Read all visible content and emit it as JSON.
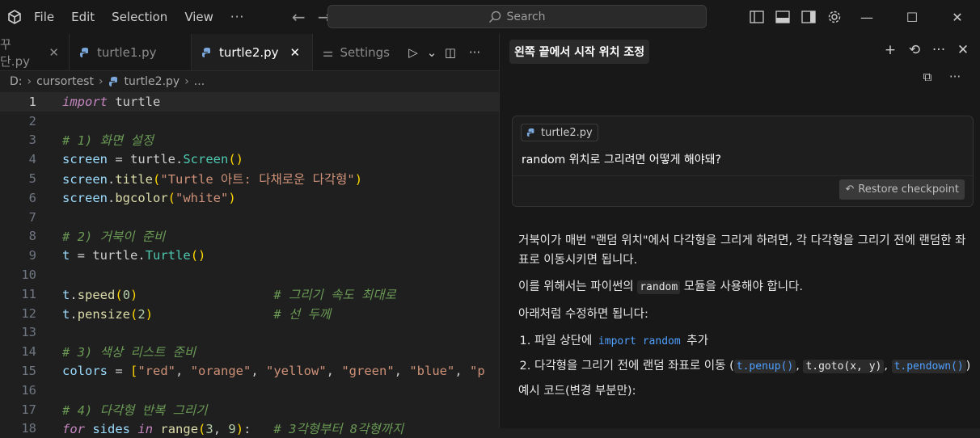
{
  "menu": {
    "file": "File",
    "edit": "Edit",
    "selection": "Selection",
    "view": "View",
    "more": "···"
  },
  "search": {
    "placeholder": "Search"
  },
  "tabs": [
    {
      "label": "꾸단.py",
      "close": "✕"
    },
    {
      "label": "turtle1.py"
    },
    {
      "label": "turtle2.py",
      "close": "✕"
    },
    {
      "label": "Settings"
    }
  ],
  "breadcrumb": {
    "drive": "D:",
    "folder": "cursortest",
    "file": "turtle2.py",
    "more": "..."
  },
  "code": {
    "l1": "1",
    "l2": "2",
    "l3": "3",
    "l4": "4",
    "l5": "5",
    "l6": "6",
    "l7": "7",
    "l8": "8",
    "l9": "9",
    "l10": "10",
    "l11": "11",
    "l12": "12",
    "l13": "13",
    "l14": "14",
    "l15": "15",
    "l16": "16",
    "l17": "17",
    "l18": "18",
    "c3": "# 1) 화면 설정",
    "c8": "# 2) 거북이 준비",
    "c11": "# 그리기 속도 최대로",
    "c12": "# 선 두께",
    "c14": "# 3) 색상 리스트 준비",
    "c17": "# 4) 다각형 반복 그리기",
    "c18": "# 3각형부터 8각형까지",
    "s5": "\"Turtle 아트: 다채로운 다각형\"",
    "s6": "\"white\"",
    "s15a": "\"red\"",
    "s15b": "\"orange\"",
    "s15c": "\"yellow\"",
    "s15d": "\"green\"",
    "s15e": "\"blue\"",
    "s15f": "\"p"
  },
  "chat": {
    "title": "왼쪽 끝에서 시작 위치 조정",
    "file_chip": "turtle2.py",
    "user_message": "random 위치로 그리려면 어떻게 해야돼?",
    "restore": "Restore checkpoint",
    "p1": "거북이가 매번 \"랜덤 위치\"에서 다각형을 그리게 하려면, 각 다각형을 그리기 전에 랜덤한 좌표로 이동시키면 됩니다.",
    "p2a": "이를 위해서는 파이썬의 ",
    "p2code": "random",
    "p2b": " 모듈을 사용해야 합니다.",
    "p3": "아래처럼 수정하면 됩니다:",
    "li1a": "파일 상단에 ",
    "li1code": "import random",
    "li1b": " 추가",
    "li2a": "다각형을 그리기 전에 랜덤 좌표로 이동 (",
    "li2c1": "t.penup()",
    "li2c2": "t.goto(x, y)",
    "li2c3": "t.pendown()",
    "li2b": ")",
    "p4": "예시 코드(변경 부분만):"
  }
}
